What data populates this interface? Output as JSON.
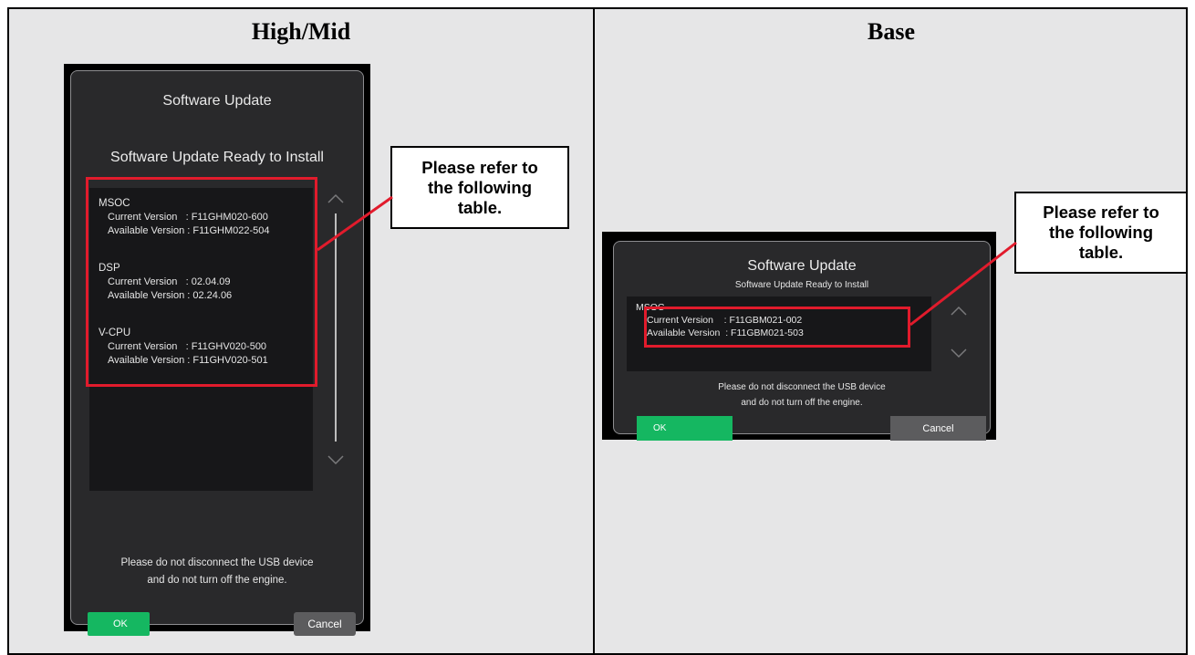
{
  "columns": {
    "left_title": "High/Mid",
    "right_title": "Base"
  },
  "high_mid": {
    "title": "Software Update",
    "subtitle": "Software Update Ready to Install",
    "components": [
      {
        "name": "MSOC",
        "current": "Current Version   : F11GHM020-600",
        "available": "Available Version : F11GHM022-504"
      },
      {
        "name": "DSP",
        "current": "Current Version   : 02.04.09",
        "available": "Available Version : 02.24.06"
      },
      {
        "name": "V-CPU",
        "current": "Current Version   : F11GHV020-500",
        "available": "Available Version : F11GHV020-501"
      }
    ],
    "notice_line1": "Please do not disconnect the USB device",
    "notice_line2": "and do not turn off the engine.",
    "ok_label": "OK",
    "cancel_label": "Cancel",
    "callout": [
      "Please refer to",
      "the following",
      "table."
    ]
  },
  "base": {
    "title": "Software Update",
    "subtitle": "Software Update Ready to Install",
    "component_name": "MSOC",
    "current": "Current Version    : F11GBM021-002",
    "available": "Available Version  : F11GBM021-503",
    "notice_line1": "Please do not disconnect the USB device",
    "notice_line2": "and do not turn off the engine.",
    "ok_label": "OK",
    "cancel_label": "Cancel",
    "callout": [
      "Please refer to",
      "the following",
      "table."
    ]
  },
  "colors": {
    "highlight": "#e11b2c",
    "ok_button": "#15b761",
    "cancel_button": "#5c5c5e",
    "panel_bg": "#e6e6e7"
  },
  "icons": [
    "chevron-up-icon",
    "chevron-down-icon"
  ]
}
